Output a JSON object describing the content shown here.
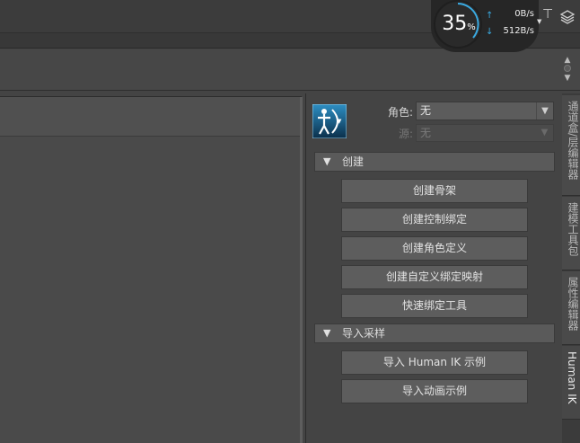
{
  "net_monitor": {
    "percent": "35",
    "percent_unit": "%",
    "upload_speed": "0B/s",
    "download_speed": "512B/s"
  },
  "hik_panel": {
    "role_label": "角色:",
    "role_value": "无",
    "source_label": "源:",
    "source_value": "无",
    "sections": {
      "create": {
        "title": "创建",
        "buttons": [
          "创建骨架",
          "创建控制绑定",
          "创建角色定义",
          "创建自定义绑定映射",
          "快速绑定工具"
        ]
      },
      "import": {
        "title": "导入采样",
        "buttons": [
          "导入 Human IK 示例",
          "导入动画示例"
        ]
      }
    }
  },
  "side_tabs": [
    "通道盒/层编辑器",
    "建模工具包",
    "属性编辑器",
    "Human IK"
  ],
  "colors": {
    "accent": "#3aa9e0",
    "panel_bg": "#444444"
  }
}
